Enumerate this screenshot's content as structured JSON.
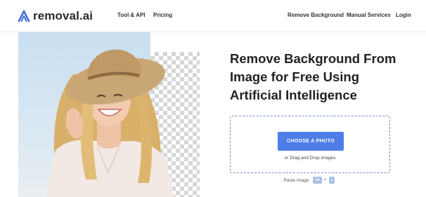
{
  "header": {
    "logo_text": "removal.ai",
    "nav_left": [
      {
        "label": "Tool & API"
      },
      {
        "label": "Pricing"
      }
    ],
    "nav_right": [
      {
        "label": "Remove Background"
      },
      {
        "label": "Manual Services"
      },
      {
        "label": "Login"
      }
    ]
  },
  "hero": {
    "headline_lines": [
      "Remove Background From",
      "Image for Free Using",
      "Artificial Intelligence"
    ]
  },
  "upload": {
    "button_label": "CHOOSE A PHOTO",
    "drag_text": "or Drag and Drop images",
    "paste_label": "Paste image",
    "key_ctrl": "ctrl",
    "key_plus": "+",
    "key_v": "v"
  },
  "colors": {
    "accent": "#4f7ee8",
    "dropzone_border": "#6c8fc5",
    "text_dark": "#222222"
  }
}
